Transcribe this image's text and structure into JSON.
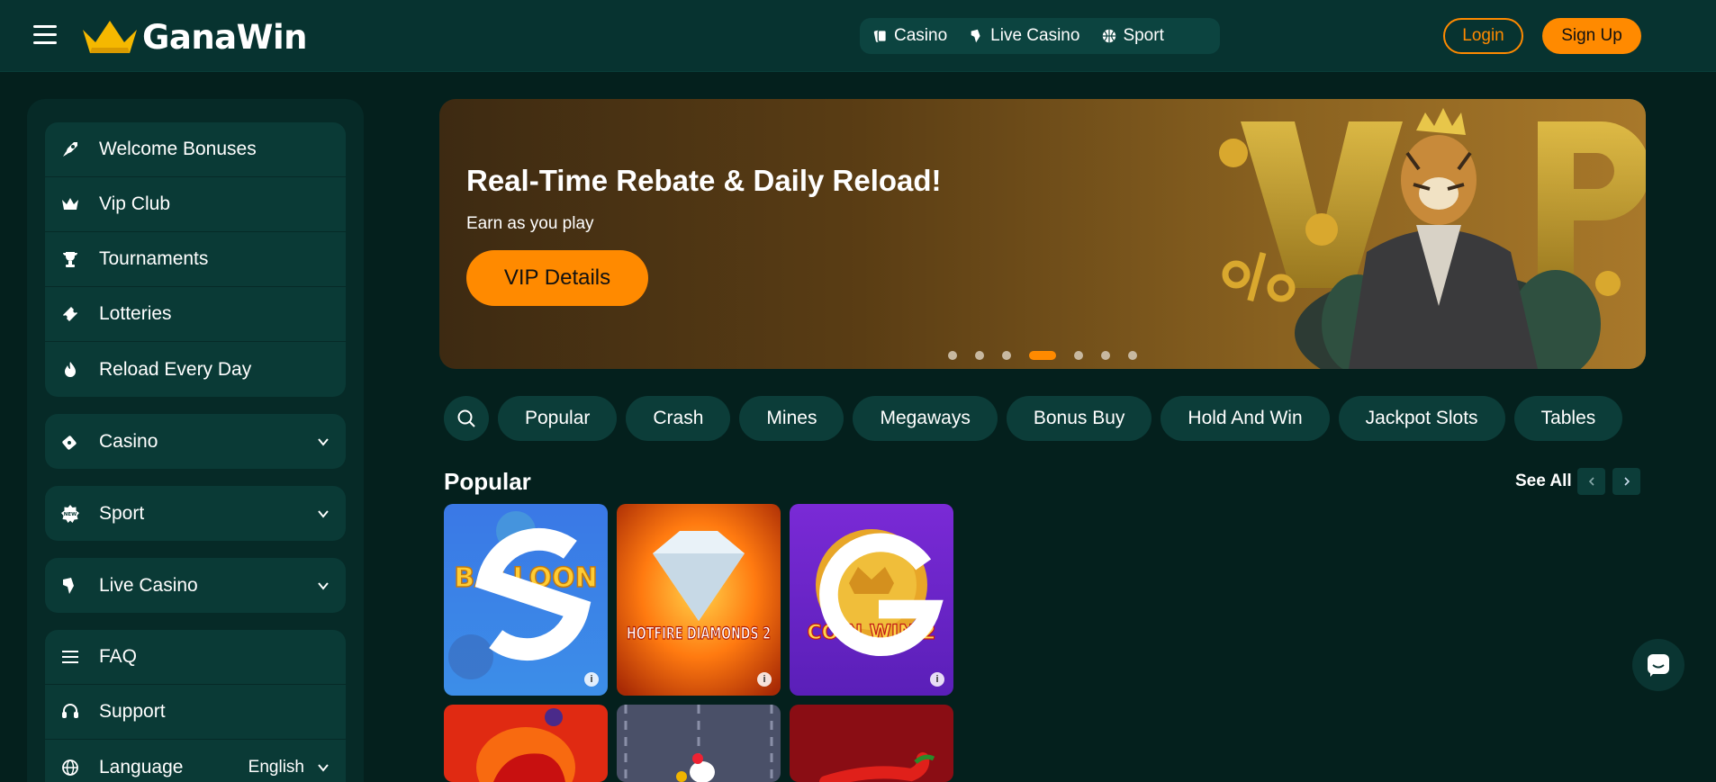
{
  "header": {
    "logo_text": "GanaWin",
    "nav": [
      {
        "label": "Casino",
        "icon": "cards-icon"
      },
      {
        "label": "Live Casino",
        "icon": "live-dealer-icon"
      },
      {
        "label": "Sport",
        "icon": "basketball-icon"
      }
    ],
    "login_label": "Login",
    "signup_label": "Sign Up"
  },
  "sidebar": {
    "promos": [
      {
        "label": "Welcome Bonuses",
        "icon": "rocket-icon"
      },
      {
        "label": "Vip Club",
        "icon": "crown-icon"
      },
      {
        "label": "Tournaments",
        "icon": "trophy-icon"
      },
      {
        "label": "Lotteries",
        "icon": "ticket-icon"
      },
      {
        "label": "Reload Every Day",
        "icon": "flame-icon"
      }
    ],
    "casino": {
      "label": "Casino",
      "icon": "cards-icon"
    },
    "sport": {
      "label": "Sport",
      "icon": "sport-new-icon"
    },
    "live_casino": {
      "label": "Live Casino",
      "icon": "live-dealer-icon"
    },
    "info": [
      {
        "label": "FAQ",
        "icon": "list-icon"
      },
      {
        "label": "Support",
        "icon": "headset-icon"
      },
      {
        "label": "Language",
        "icon": "globe-icon",
        "value": "English"
      }
    ]
  },
  "banner": {
    "title": "Real-Time Rebate & Daily Reload!",
    "subtitle": "Earn as you play",
    "button_label": "VIP Details",
    "slide_count": 7,
    "active_slide": 4
  },
  "categories": [
    "Popular",
    "Crash",
    "Mines",
    "Megaways",
    "Bonus Buy",
    "Hold And Win",
    "Jackpot Slots",
    "Tables"
  ],
  "section": {
    "title": "Popular",
    "see_all_label": "See All"
  },
  "games": [
    {
      "name": "Balloon",
      "art_text": "BALLOON"
    },
    {
      "name": "Hotfire Diamonds 2",
      "art_text": "HOTFIRE DIAMONDS 2"
    },
    {
      "name": "Coin Win 2",
      "art_text": "COIN WIN 2"
    }
  ],
  "colors": {
    "accent": "#ff8a00",
    "background": "#04201d",
    "panel": "#0a3a36"
  }
}
